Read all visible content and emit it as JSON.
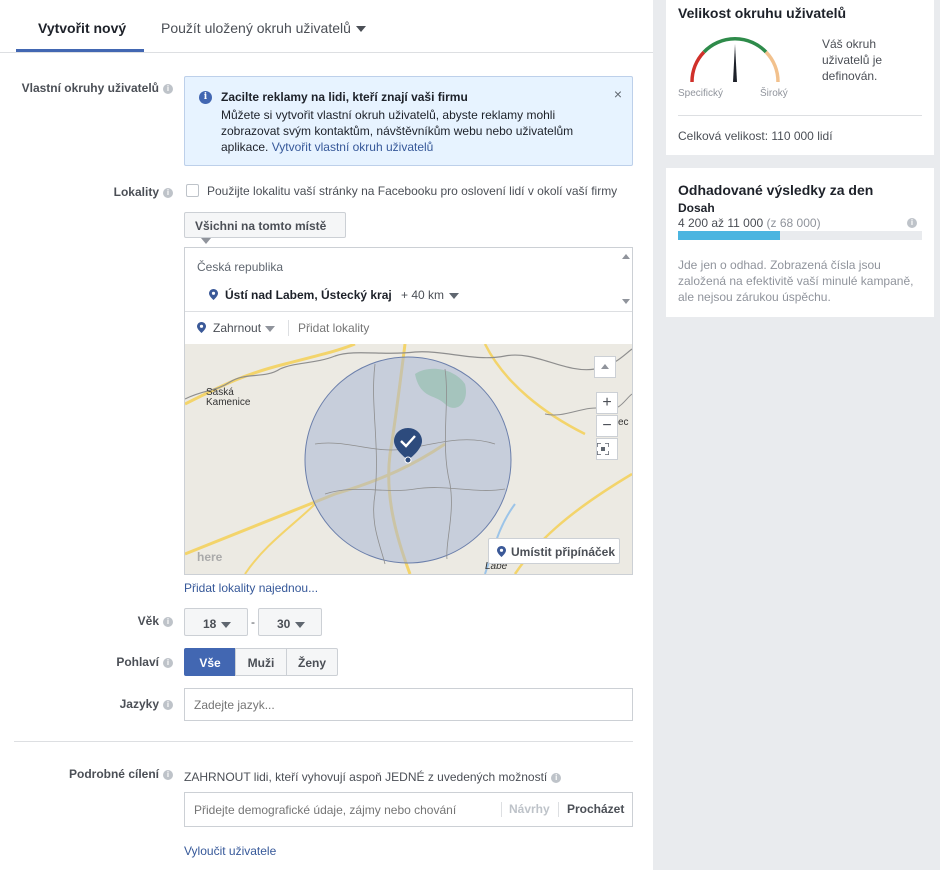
{
  "tabs": {
    "create_new": "Vytvořit nový",
    "use_saved": "Použít uložený okruh uživatelů"
  },
  "custom_audiences": {
    "label": "Vlastní okruhy uživatelů",
    "notice_title": "Zacilte reklamy na lidi, kteří znají vaši firmu",
    "notice_body": "Můžete si vytvořit vlastní okruh uživatelů, abyste reklamy mohli zobrazovat svým kontaktům, návštěvníkům webu nebo uživatelům aplikace.",
    "notice_link": "Vytvořit vlastní okruh uživatelů",
    "close_symbol": "×"
  },
  "locations": {
    "label": "Lokality",
    "checkbox_label": "Použijte lokalitu vaší stránky na Facebooku pro oslovení lidí v okolí vaší firmy",
    "people_filter": "Všichni na tomto místě",
    "country": "Česká republika",
    "city": "Ústí nad Labem, Ústecký kraj",
    "radius": "+ 40 km",
    "include_mode": "Zahrnout",
    "add_placeholder": "Přidat lokality",
    "drop_pin": "Umístit připínáček",
    "bulk_add_link": "Přidat lokality najednou...",
    "map_labels": {
      "town": "Saská\nKamenice",
      "river": "Labe",
      "watermark": "here",
      "edge_text": "ec"
    },
    "zoom_in": "+",
    "zoom_out": "−"
  },
  "age": {
    "label": "Věk",
    "min": "18",
    "separator": "-",
    "max": "30"
  },
  "gender": {
    "label": "Pohlaví",
    "options": [
      "Vše",
      "Muži",
      "Ženy"
    ],
    "selected": "Vše"
  },
  "languages": {
    "label": "Jazyky",
    "placeholder": "Zadejte jazyk..."
  },
  "detailed_targeting": {
    "label": "Podrobné cílení",
    "include_text": "ZAHRNOUT lidi, kteří vyhovují aspoň JEDNÉ z uvedených možností",
    "placeholder": "Přidejte demografické údaje, zájmy nebo chování",
    "suggestions": "Návrhy",
    "browse": "Procházet",
    "exclude_link": "Vyloučit uživatele"
  },
  "audience_size": {
    "title": "Velikost okruhu uživatelů",
    "description": "Váš okruh uživatelů je definován.",
    "specific": "Specifický",
    "broad": "Široký",
    "potential_reach": "Celková velikost: 110 000 lidí"
  },
  "daily_results": {
    "title": "Odhadované výsledky za den",
    "reach_label": "Dosah",
    "reach_range": "4 200 až 11 000",
    "reach_total": "(z 68 000)",
    "reach_fill_fraction": 0.42,
    "disclaimer": "Jde jen o odhad. Zobrazená čísla jsou založená na efektivitě vaší minulé kampaně, ale nejsou zárukou úspěchu."
  },
  "colors": {
    "accent": "#4267b2",
    "reach_bar": "#4bb5e0",
    "radius_fill": "#a9b7d6"
  }
}
